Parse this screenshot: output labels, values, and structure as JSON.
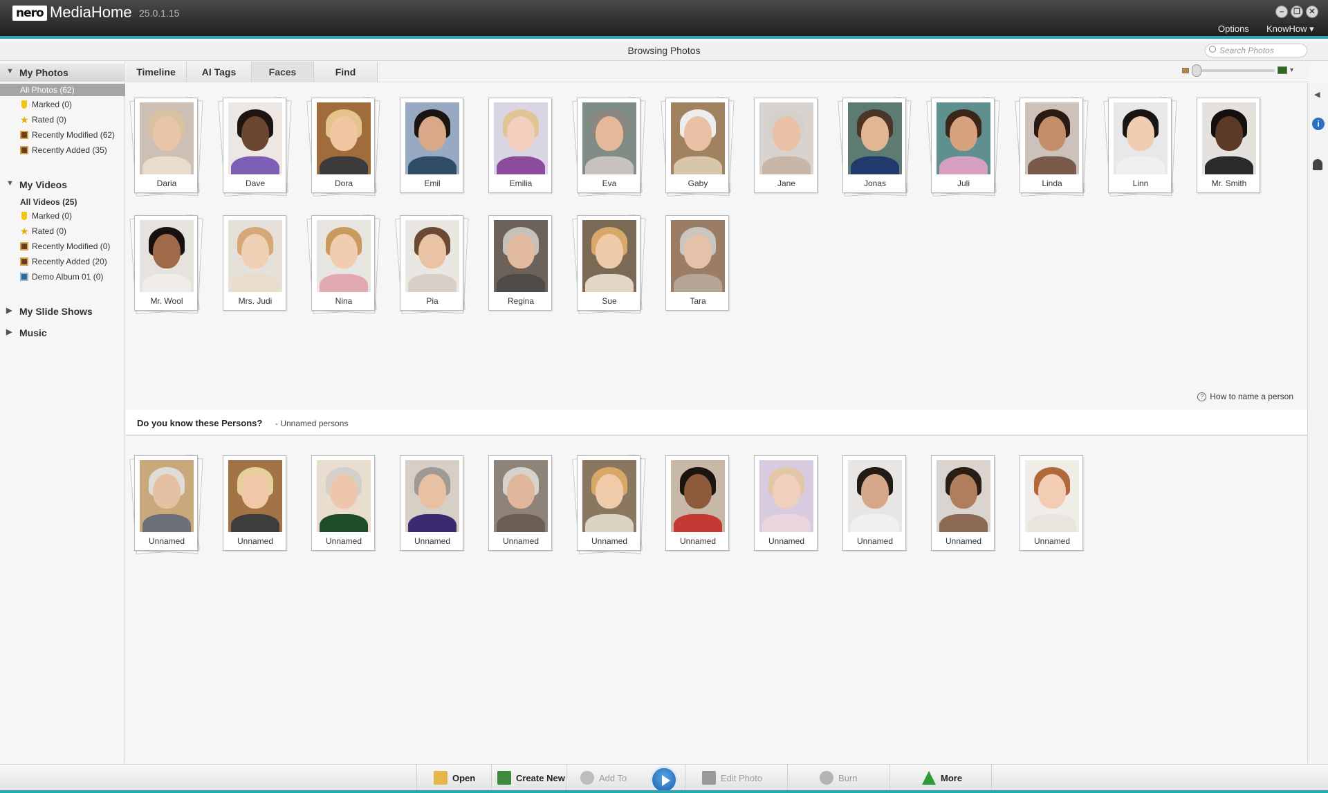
{
  "app": {
    "logo": "nero",
    "name": "MediaHome",
    "version": "25.0.1.15",
    "menu": {
      "options": "Options",
      "knowhow": "KnowHow ▾"
    },
    "browsing": "Browsing Photos",
    "search_placeholder": "Search Photos",
    "accent": "#2aa7b0"
  },
  "sidebar": {
    "photos_header": "My Photos",
    "photos_items": [
      {
        "label": "All Photos (62)"
      },
      {
        "label": "Marked (0)",
        "icon": "marker-icon"
      },
      {
        "label": "Rated (0)",
        "icon": "star-icon"
      },
      {
        "label": "Recently Modified (62)",
        "icon": "album-icon"
      },
      {
        "label": "Recently Added (35)",
        "icon": "album-icon"
      }
    ],
    "videos_header": "My Videos",
    "videos_items": [
      {
        "label": "All Videos (25)"
      },
      {
        "label": "Marked (0)",
        "icon": "marker-icon"
      },
      {
        "label": "Rated (0)",
        "icon": "star-icon"
      },
      {
        "label": "Recently Modified (0)",
        "icon": "album-icon"
      },
      {
        "label": "Recently Added (20)",
        "icon": "album-icon"
      },
      {
        "label": "Demo Album 01 (0)",
        "icon": "album-icon"
      }
    ],
    "slideshows_header": "My Slide Shows",
    "music_header": "Music"
  },
  "tabs": [
    {
      "label": "Timeline"
    },
    {
      "label": "AI Tags"
    },
    {
      "label": "Faces",
      "active": true
    },
    {
      "label": "Find"
    }
  ],
  "faces": [
    {
      "name": "Daria",
      "skin": "#e8c4a8",
      "hair": "#d8c2a0",
      "cloth": "#e9dccb",
      "bg": "#cdbfb3",
      "stack": true
    },
    {
      "name": "Dave",
      "skin": "#6b4630",
      "hair": "#1f1510",
      "cloth": "#7c5fb5",
      "bg": "#ece7e2",
      "stack": true
    },
    {
      "name": "Dora",
      "skin": "#f0c6a3",
      "hair": "#e3c48a",
      "cloth": "#3b3b3b",
      "bg": "#a06c3c",
      "stack": true
    },
    {
      "name": "Emil",
      "skin": "#d9a888",
      "hair": "#1b1512",
      "cloth": "#2f4b66",
      "bg": "#98aac2",
      "stack": false
    },
    {
      "name": "Emilia",
      "skin": "#f2cfbe",
      "hair": "#e2c595",
      "cloth": "#8d4b9c",
      "bg": "#d9d5e2",
      "stack": false
    },
    {
      "name": "Eva",
      "skin": "#e6b89a",
      "hair": "#8d8781",
      "cloth": "#c8c2bd",
      "bg": "#7f8d86",
      "stack": true
    },
    {
      "name": "Gaby",
      "skin": "#e8c1a4",
      "hair": "#ededed",
      "cloth": "#d7c6a8",
      "bg": "#a08260",
      "stack": true
    },
    {
      "name": "Jane",
      "skin": "#e8c1a7",
      "hair": "#d4d0cb",
      "cloth": "#c8b7a8",
      "bg": "#d8d3ce",
      "stack": false
    },
    {
      "name": "Jonas",
      "skin": "#e2b693",
      "hair": "#4a3526",
      "cloth": "#203b6b",
      "bg": "#5d7b73",
      "stack": true
    },
    {
      "name": "Juli",
      "skin": "#d7a37e",
      "hair": "#3a2518",
      "cloth": "#d7a0bf",
      "bg": "#5f8f8e",
      "stack": true
    },
    {
      "name": "Linda",
      "skin": "#c48e6b",
      "hair": "#2a1a12",
      "cloth": "#7a5a4b",
      "bg": "#ccc2bb",
      "stack": true
    },
    {
      "name": "Linn",
      "skin": "#f0ccb0",
      "hair": "#1a1412",
      "cloth": "#f0f0f0",
      "bg": "#e8e8ea",
      "stack": true
    },
    {
      "name": "Mr. Smith",
      "skin": "#5b3a27",
      "hair": "#151010",
      "cloth": "#2b2b2b",
      "bg": "#e5e1dd",
      "stack": false
    },
    {
      "name": "Mr. Wool",
      "skin": "#a06a4a",
      "hair": "#161010",
      "cloth": "#f0ede8",
      "bg": "#e6e3df",
      "stack": true
    },
    {
      "name": "Mrs. Judi",
      "skin": "#f0d0b5",
      "hair": "#d5a878",
      "cloth": "#e8dccd",
      "bg": "#e6e0da",
      "stack": false
    },
    {
      "name": "Nina",
      "skin": "#f0cdb1",
      "hair": "#c99a5e",
      "cloth": "#e2a9b3",
      "bg": "#e7e5e0",
      "stack": true
    },
    {
      "name": "Pia",
      "skin": "#e9c3a3",
      "hair": "#6b4a33",
      "cloth": "#d8d0c6",
      "bg": "#eae6e1",
      "stack": true
    },
    {
      "name": "Regina",
      "skin": "#e2ba9e",
      "hair": "#c4c0bb",
      "cloth": "#4f4a45",
      "bg": "#6d625a",
      "stack": false
    },
    {
      "name": "Sue",
      "skin": "#eecaa9",
      "hair": "#d8a86a",
      "cloth": "#e3d6c4",
      "bg": "#7a6a55",
      "stack": true
    },
    {
      "name": "Tara",
      "skin": "#e5c1a9",
      "hair": "#c9c6c2",
      "cloth": "#b5a597",
      "bg": "#9b7c65",
      "stack": false
    }
  ],
  "howto": "How to name a person",
  "unnamed_section": {
    "title": "Do you know these Persons?",
    "subtitle": "- Unnamed persons"
  },
  "unnamed": [
    {
      "name": "Unnamed",
      "skin": "#e6c0a2",
      "hair": "#e0ddd8",
      "cloth": "#6b6f78",
      "bg": "#c9a87b",
      "stack": true
    },
    {
      "name": "Unnamed",
      "skin": "#f0c7a7",
      "hair": "#e6cf9c",
      "cloth": "#3d3d3d",
      "bg": "#a27445",
      "stack": false
    },
    {
      "name": "Unnamed",
      "skin": "#eec6ab",
      "hair": "#d3d0cb",
      "cloth": "#1e4d2a",
      "bg": "#e9ddd0",
      "stack": false
    },
    {
      "name": "Unnamed",
      "skin": "#e8c0a2",
      "hair": "#a09a94",
      "cloth": "#3a2a70",
      "bg": "#d6cfc6",
      "stack": false
    },
    {
      "name": "Unnamed",
      "skin": "#e0b79a",
      "hair": "#d7d2cc",
      "cloth": "#6a5e55",
      "bg": "#8e8379",
      "stack": false
    },
    {
      "name": "Unnamed",
      "skin": "#efcbaa",
      "hair": "#d9a867",
      "cloth": "#ddd3c4",
      "bg": "#8a775f",
      "stack": true
    },
    {
      "name": "Unnamed",
      "skin": "#8e5a3c",
      "hair": "#1b1512",
      "cloth": "#c33a34",
      "bg": "#c8b8a8",
      "stack": false
    },
    {
      "name": "Unnamed",
      "skin": "#f0d0bd",
      "hair": "#e1c7a6",
      "cloth": "#e9d5dd",
      "bg": "#d8cbe0",
      "stack": false
    },
    {
      "name": "Unnamed",
      "skin": "#d7a78a",
      "hair": "#221a15",
      "cloth": "#f0f0f0",
      "bg": "#e8e6e4",
      "stack": false
    },
    {
      "name": "Unnamed",
      "skin": "#b07e5c",
      "hair": "#2a1d15",
      "cloth": "#8c6b55",
      "bg": "#d9d4cf",
      "stack": false
    },
    {
      "name": "Unnamed",
      "skin": "#f2cdb3",
      "hair": "#b06a3a",
      "cloth": "#e8e4de",
      "bg": "#f0ede9",
      "stack": false
    }
  ],
  "toolbar": {
    "open": "Open",
    "create_new": "Create New",
    "add_to": "Add To",
    "edit_photo": "Edit Photo",
    "burn": "Burn",
    "more": "More"
  }
}
